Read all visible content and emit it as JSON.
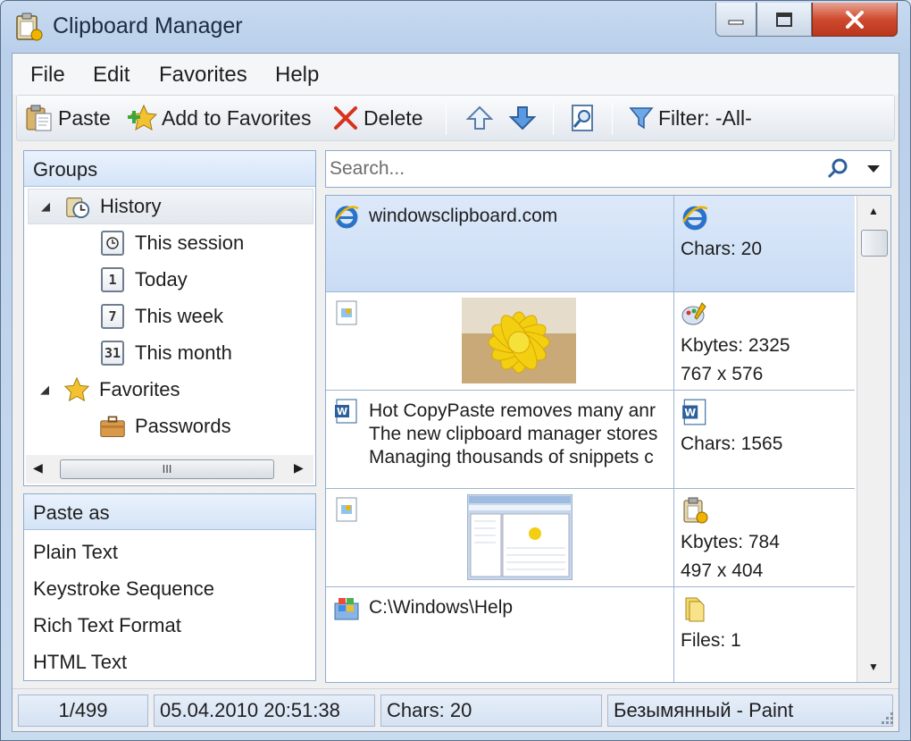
{
  "window": {
    "title": "Clipboard Manager"
  },
  "menu": [
    "File",
    "Edit",
    "Favorites",
    "Help"
  ],
  "toolbar": {
    "paste": "Paste",
    "add_favorites": "Add to Favorites",
    "delete": "Delete",
    "filter": "Filter: -All-"
  },
  "groups": {
    "header": "Groups",
    "items": [
      {
        "label": "History",
        "icon": "history-clock-icon"
      },
      {
        "label": "This session",
        "icon": "session-icon"
      },
      {
        "label": "Today",
        "icon": "calendar-icon",
        "num": "1"
      },
      {
        "label": "This week",
        "icon": "calendar-icon",
        "num": "7"
      },
      {
        "label": "This month",
        "icon": "calendar-icon",
        "num": "31"
      },
      {
        "label": "Favorites",
        "icon": "star-icon"
      },
      {
        "label": "Passwords",
        "icon": "briefcase-icon"
      }
    ],
    "scroll_glyph": "III"
  },
  "paste_as": {
    "header": "Paste as",
    "items": [
      "Plain Text",
      "Keystroke Sequence",
      "Rich Text Format",
      "HTML Text"
    ]
  },
  "search": {
    "placeholder": "Search..."
  },
  "clips": [
    {
      "type": "url",
      "text": [
        "windowsclipboard.com"
      ],
      "info": [
        "Chars: 20"
      ]
    },
    {
      "type": "image",
      "text": [],
      "info": [
        "Kbytes: 2325",
        "767 x 576"
      ]
    },
    {
      "type": "rtf",
      "text": [
        "Hot CopyPaste removes many anr",
        "The new clipboard manager stores",
        "Managing thousands of snippets c"
      ],
      "info": [
        "Chars: 1565"
      ]
    },
    {
      "type": "image",
      "text": [],
      "info": [
        "Kbytes: 784",
        "497 x 404"
      ]
    },
    {
      "type": "files",
      "text": [
        "C:\\Windows\\Help"
      ],
      "info": [
        "Files: 1"
      ]
    }
  ],
  "status": {
    "position": "1/499",
    "timestamp": "05.04.2010 20:51:38",
    "chars": "Chars: 20",
    "source": "Безымянный - Paint"
  },
  "colors": {
    "accent": "#c9dcf5",
    "close_button": "#cf4a2e",
    "panel_header": "#d4e4f7"
  }
}
